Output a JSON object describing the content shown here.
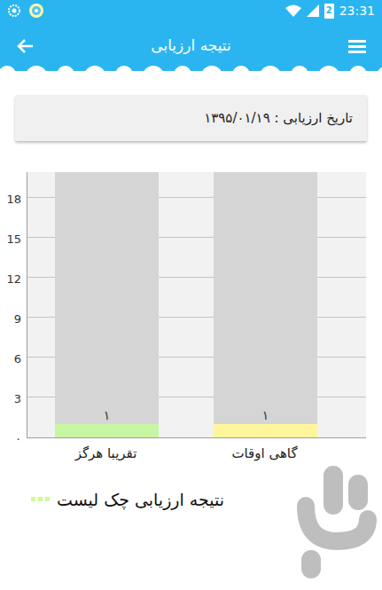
{
  "status_bar": {
    "time": "23:31",
    "battery": "2"
  },
  "app_bar": {
    "title": "نتیجه ارزیابی"
  },
  "date_card": {
    "text": "تاریخ ارزیابی : ۱۳۹۵/۰۱/۱۹"
  },
  "chart": {
    "max": 20,
    "y_ticks": [
      {
        "label": "18",
        "value": 18
      },
      {
        "label": "15",
        "value": 15
      },
      {
        "label": "12",
        "value": 12
      },
      {
        "label": "9",
        "value": 9
      },
      {
        "label": "6",
        "value": 6
      },
      {
        "label": "3",
        "value": 3
      },
      {
        "label": "۰",
        "value": 0
      }
    ],
    "bars": [
      {
        "category": "تقریبا هرگز",
        "value": 1,
        "value_label": "۱",
        "color": "#c8f5a2"
      },
      {
        "category": "گاهی اوقات",
        "value": 1,
        "value_label": "۱",
        "color": "#fff59d"
      }
    ],
    "legend": {
      "label": "نتیجه ارزیابی چک لیست",
      "color": "#ccff90"
    }
  }
}
